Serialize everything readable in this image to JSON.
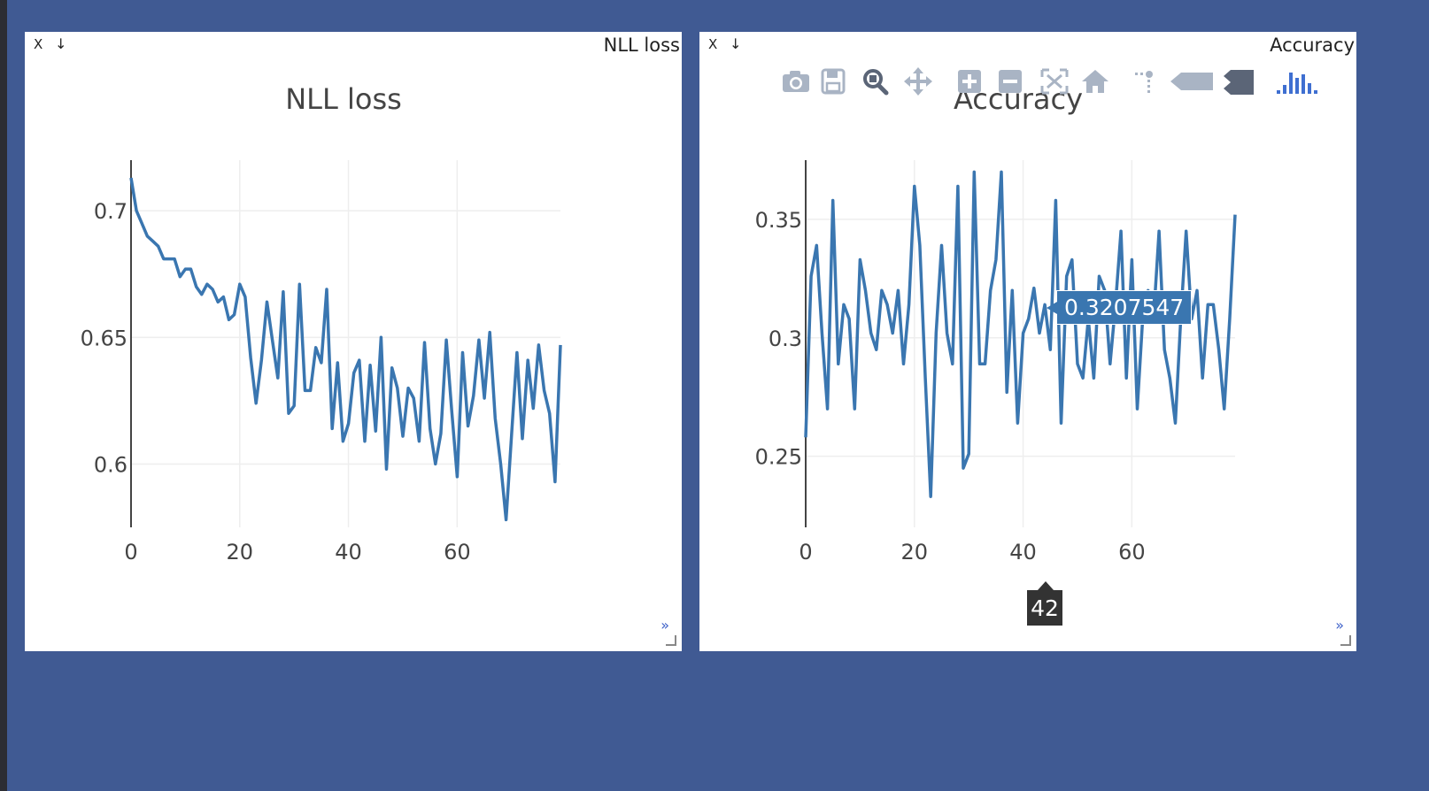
{
  "panes": [
    {
      "name": "NLL loss",
      "close_label": "X",
      "download_label": "↓",
      "expand_label": "»"
    },
    {
      "name": "Accuracy",
      "close_label": "X",
      "download_label": "↓",
      "expand_label": "»"
    }
  ],
  "modebar": {
    "icons": [
      "camera-icon",
      "save-icon",
      "zoom-icon",
      "pan-icon",
      "zoom-in-icon",
      "zoom-out-icon",
      "autoscale-icon",
      "home-icon",
      "spike-lines-icon",
      "hover-closest-icon",
      "hover-compare-icon",
      "plotly-logo-icon"
    ],
    "icon_color": "#a9b4c4",
    "logo_color": "#3f6fd1"
  },
  "hover": {
    "y_value": "0.3207547",
    "x_value": "42"
  },
  "colors": {
    "line": "#3a76b0",
    "background": "#405a93",
    "grid": "#eeeeee"
  },
  "chart_data": [
    {
      "type": "line",
      "title": "NLL loss",
      "xlabel": "",
      "ylabel": "",
      "xlim": [
        0,
        79
      ],
      "ylim": [
        0.575,
        0.72
      ],
      "xticks": [
        0,
        20,
        40,
        60
      ],
      "xtick_labels": [
        "0",
        "20",
        "40",
        "60"
      ],
      "yticks": [
        0.6,
        0.65,
        0.7
      ],
      "ytick_labels": [
        "0.6",
        "0.65",
        "0.7"
      ],
      "grid": true,
      "series": [
        {
          "x": [
            0,
            1,
            2,
            3,
            4,
            5,
            6,
            7,
            8,
            9,
            10,
            11,
            12,
            13,
            14,
            15,
            16,
            17,
            18,
            19,
            20,
            21,
            22,
            23,
            24,
            25,
            26,
            27,
            28,
            29,
            30,
            31,
            32,
            33,
            34,
            35,
            36,
            37,
            38,
            39,
            40,
            41,
            42,
            43,
            44,
            45,
            46,
            47,
            48,
            49,
            50,
            51,
            52,
            53,
            54,
            55,
            56,
            57,
            58,
            59,
            60,
            61,
            62,
            63,
            64,
            65,
            66,
            67,
            68,
            69,
            70,
            71,
            72,
            73,
            74,
            75,
            76,
            77,
            78,
            79
          ],
          "y": [
            0.713,
            0.7,
            0.695,
            0.69,
            0.688,
            0.686,
            0.681,
            0.681,
            0.681,
            0.674,
            0.677,
            0.677,
            0.67,
            0.667,
            0.671,
            0.669,
            0.664,
            0.666,
            0.657,
            0.659,
            0.671,
            0.666,
            0.642,
            0.624,
            0.641,
            0.664,
            0.649,
            0.634,
            0.668,
            0.62,
            0.623,
            0.671,
            0.629,
            0.629,
            0.646,
            0.64,
            0.669,
            0.614,
            0.64,
            0.609,
            0.616,
            0.636,
            0.641,
            0.609,
            0.639,
            0.613,
            0.65,
            0.598,
            0.638,
            0.63,
            0.611,
            0.63,
            0.626,
            0.609,
            0.648,
            0.614,
            0.6,
            0.612,
            0.649,
            0.621,
            0.595,
            0.644,
            0.615,
            0.627,
            0.649,
            0.626,
            0.652,
            0.618,
            0.6,
            0.578,
            0.611,
            0.644,
            0.61,
            0.641,
            0.622,
            0.647,
            0.629,
            0.62,
            0.593,
            0.647
          ]
        }
      ]
    },
    {
      "type": "line",
      "title": "Accuracy",
      "xlabel": "",
      "ylabel": "",
      "xlim": [
        0,
        79
      ],
      "ylim": [
        0.22,
        0.375
      ],
      "xticks": [
        0,
        20,
        40,
        60
      ],
      "xtick_labels": [
        "0",
        "20",
        "40",
        "60"
      ],
      "yticks": [
        0.25,
        0.3,
        0.35
      ],
      "ytick_labels": [
        "0.25",
        "0.3",
        "0.35"
      ],
      "grid": true,
      "series": [
        {
          "x": [
            0,
            1,
            2,
            3,
            4,
            5,
            6,
            7,
            8,
            9,
            10,
            11,
            12,
            13,
            14,
            15,
            16,
            17,
            18,
            19,
            20,
            21,
            22,
            23,
            24,
            25,
            26,
            27,
            28,
            29,
            30,
            31,
            32,
            33,
            34,
            35,
            36,
            37,
            38,
            39,
            40,
            41,
            42,
            43,
            44,
            45,
            46,
            47,
            48,
            49,
            50,
            51,
            52,
            53,
            54,
            55,
            56,
            57,
            58,
            59,
            60,
            61,
            62,
            63,
            64,
            65,
            66,
            67,
            68,
            69,
            70,
            71,
            72,
            73,
            74,
            75,
            76,
            77,
            78,
            79
          ],
          "y": [
            0.258,
            0.326,
            0.339,
            0.302,
            0.27,
            0.358,
            0.289,
            0.314,
            0.308,
            0.27,
            0.333,
            0.32,
            0.302,
            0.295,
            0.32,
            0.314,
            0.302,
            0.32,
            0.289,
            0.314,
            0.364,
            0.339,
            0.283,
            0.233,
            0.302,
            0.339,
            0.302,
            0.289,
            0.364,
            0.245,
            0.251,
            0.37,
            0.289,
            0.289,
            0.32,
            0.333,
            0.37,
            0.277,
            0.32,
            0.264,
            0.302,
            0.308,
            0.321,
            0.302,
            0.314,
            0.295,
            0.358,
            0.264,
            0.326,
            0.333,
            0.289,
            0.283,
            0.308,
            0.283,
            0.326,
            0.32,
            0.289,
            0.314,
            0.345,
            0.283,
            0.333,
            0.27,
            0.308,
            0.32,
            0.308,
            0.345,
            0.295,
            0.283,
            0.264,
            0.308,
            0.345,
            0.308,
            0.32,
            0.283,
            0.314,
            0.314,
            0.295,
            0.27,
            0.308,
            0.352
          ]
        }
      ]
    }
  ]
}
